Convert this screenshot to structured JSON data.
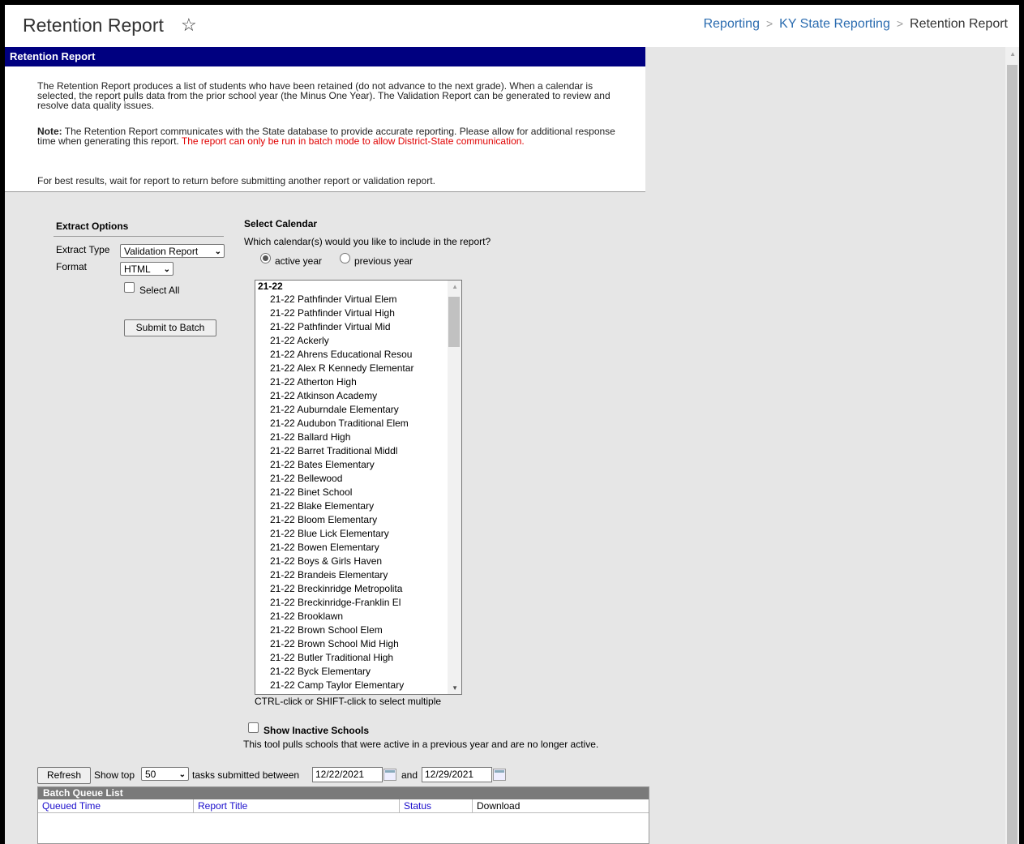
{
  "header": {
    "title": "Retention Report",
    "star_icon": "star-outline-icon",
    "breadcrumb": [
      "Reporting",
      "KY State Reporting",
      "Retention Report"
    ]
  },
  "report": {
    "bar_title": "Retention Report",
    "intro": "The Retention Report produces a list of students who have been retained (do not advance to the next grade). When a calendar is selected, the report pulls data from the prior school year (the Minus One Year). The Validation Report can be generated to review and resolve data quality issues.",
    "note_label": "Note:",
    "note_text": " The Retention Report communicates with the State database to provide accurate reporting. Please allow for additional response time when generating this report. ",
    "note_red": "The report can only be run in batch mode to allow District-State communication.",
    "best_results": "For best results, wait for report to return before submitting another report or validation report."
  },
  "extract_options": {
    "heading": "Extract Options",
    "extract_type_label": "Extract Type",
    "extract_type_value": "Validation Report",
    "format_label": "Format",
    "format_value": "HTML",
    "select_all_label": "Select All",
    "submit_label": "Submit to Batch"
  },
  "calendar": {
    "heading": "Select Calendar",
    "question": "Which calendar(s) would you like to include in the report?",
    "active_year_label": "active year",
    "previous_year_label": "previous year",
    "selected": "active year",
    "group": "21-22",
    "items": [
      "21-22 Pathfinder Virtual Elem",
      "21-22 Pathfinder Virtual High",
      "21-22 Pathfinder Virtual Mid",
      "21-22 Ackerly",
      "21-22 Ahrens Educational Resou",
      "21-22 Alex R Kennedy Elementar",
      "21-22 Atherton High",
      "21-22 Atkinson Academy",
      "21-22 Auburndale Elementary",
      "21-22 Audubon Traditional Elem",
      "21-22 Ballard High",
      "21-22 Barret Traditional Middl",
      "21-22 Bates Elementary",
      "21-22 Bellewood",
      "21-22 Binet School",
      "21-22 Blake Elementary",
      "21-22 Bloom Elementary",
      "21-22 Blue Lick Elementary",
      "21-22 Bowen Elementary",
      "21-22 Boys & Girls Haven",
      "21-22 Brandeis Elementary",
      "21-22 Breckinridge Metropolita",
      "21-22 Breckinridge-Franklin El",
      "21-22 Brooklawn",
      "21-22 Brown School Elem",
      "21-22 Brown School Mid High",
      "21-22 Butler Traditional High",
      "21-22 Byck Elementary",
      "21-22 Camp Taylor Elementary"
    ],
    "hint": "CTRL-click or SHIFT-click to select multiple",
    "inactive_label": "Show Inactive Schools",
    "inactive_desc": "This tool pulls schools that were active in a previous year and are no longer active."
  },
  "batch": {
    "refresh_label": "Refresh",
    "show_top_label": "Show top",
    "show_top_value": "50",
    "between_label": "tasks submitted between",
    "start_date": "12/22/2021",
    "and_label": "and",
    "end_date": "12/29/2021",
    "queue_title": "Batch Queue List",
    "columns": [
      "Queued Time",
      "Report Title",
      "Status",
      "Download"
    ]
  }
}
